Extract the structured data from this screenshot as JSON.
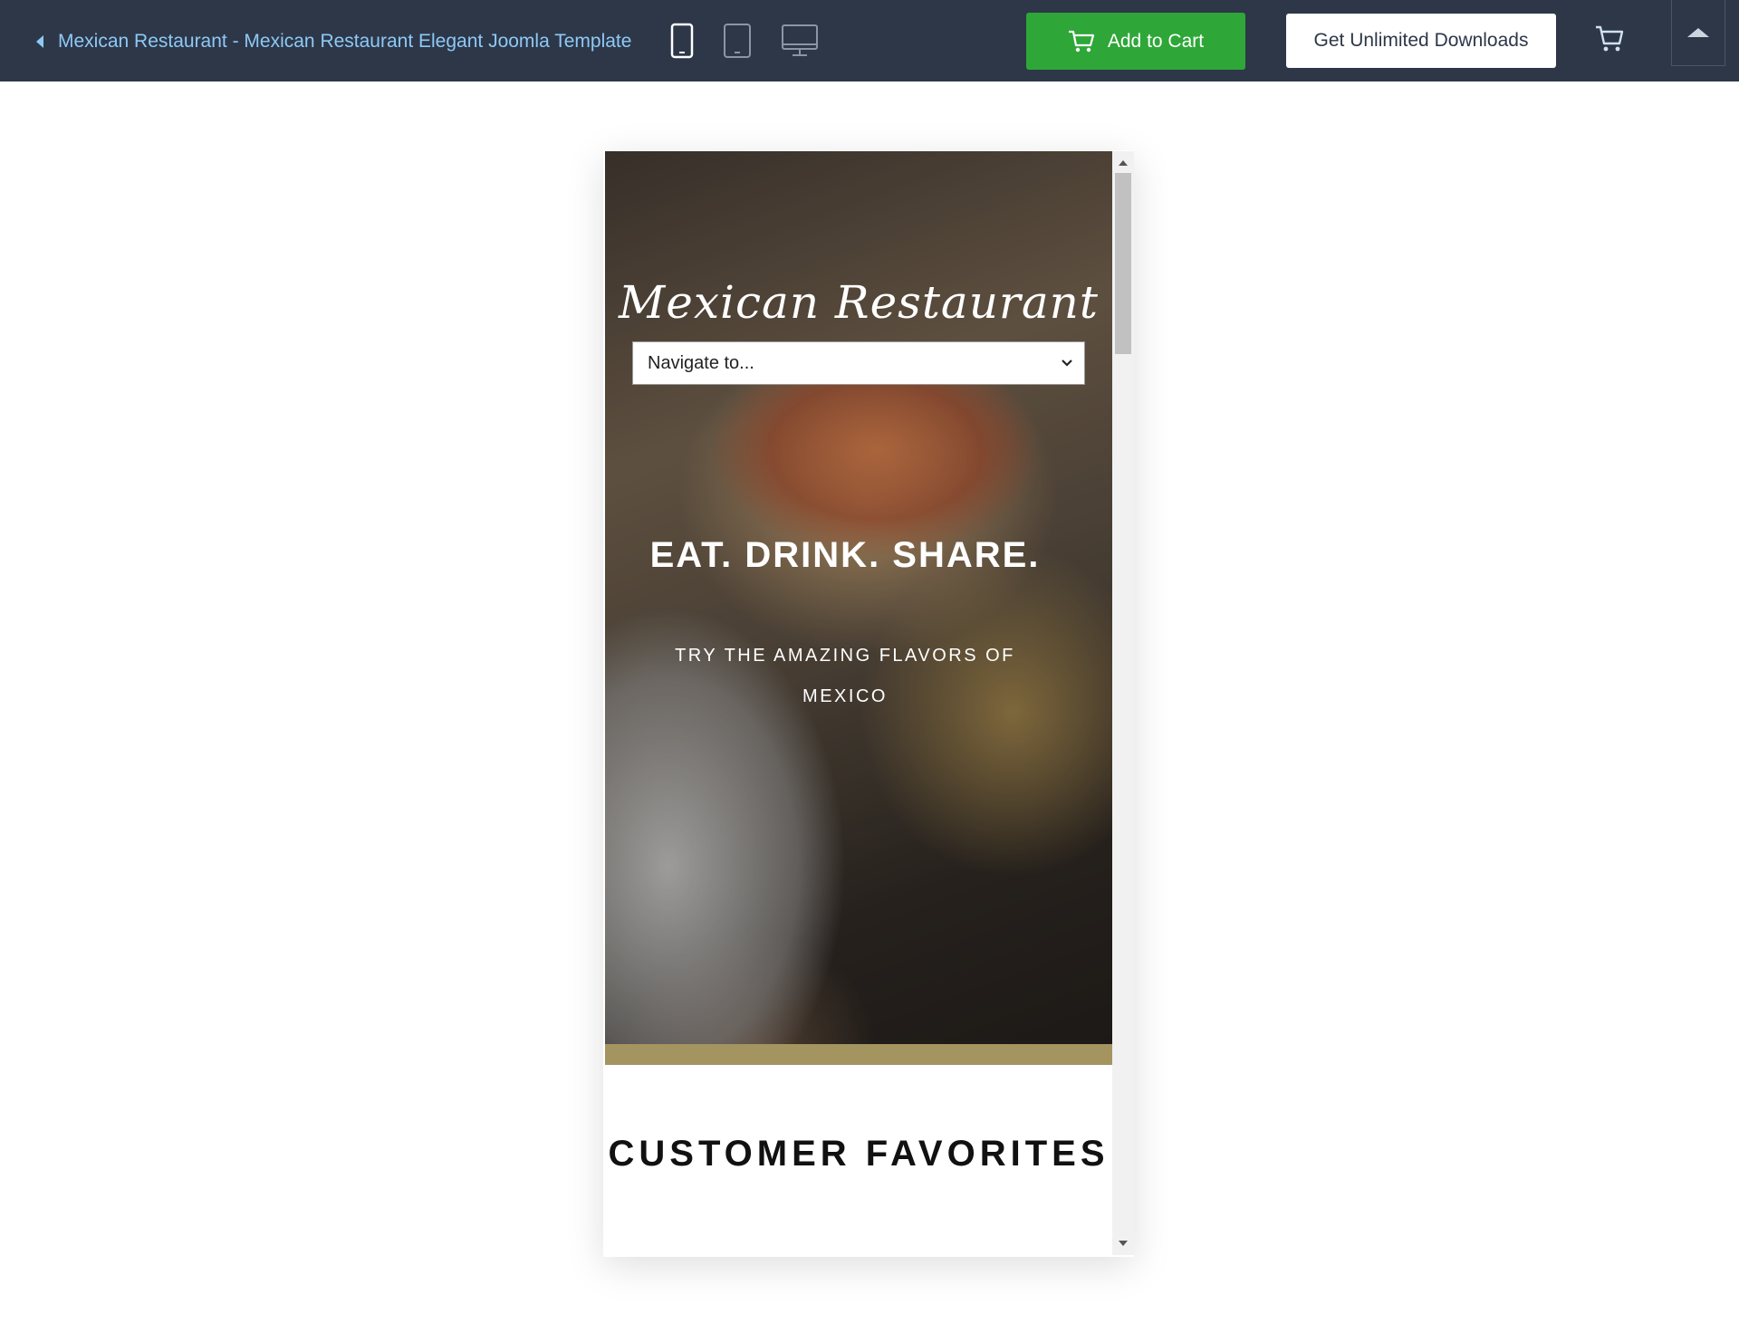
{
  "topbar": {
    "back_link": "Mexican Restaurant - Mexican Restaurant Elegant Joomla Template",
    "devices": [
      "mobile-icon",
      "tablet-icon",
      "desktop-icon"
    ],
    "add_to_cart": "Add to Cart",
    "unlimited_downloads": "Get Unlimited Downloads"
  },
  "preview": {
    "brand": "Mexican Restaurant",
    "nav_select": "Navigate to...",
    "headline": "EAT. DRINK. SHARE.",
    "tagline": "TRY THE AMAZING FLAVORS OF MEXICO",
    "section_title": "CUSTOMER FAVORITES"
  },
  "colors": {
    "topbar_bg": "#2d3748",
    "link": "#8ec9f6",
    "cart_button": "#2ea738",
    "gold_band": "#a49560"
  }
}
